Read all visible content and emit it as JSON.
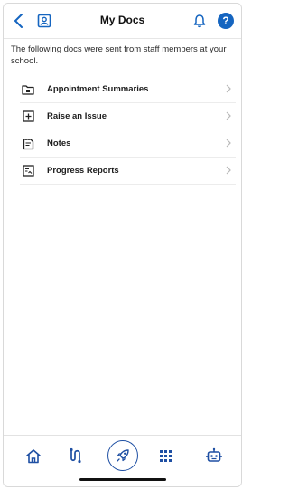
{
  "header": {
    "title": "My Docs",
    "icons": {
      "back": "back-chevron-icon",
      "profile": "profile-card-icon",
      "notifications": "bell-icon",
      "help": "help-icon"
    },
    "help_glyph": "?"
  },
  "intro_text": "The following docs were sent from staff members at your school.",
  "docs": [
    {
      "label": "Appointment Summaries",
      "icon": "folder-icon"
    },
    {
      "label": "Raise an Issue",
      "icon": "plus-box-icon"
    },
    {
      "label": "Notes",
      "icon": "note-icon"
    },
    {
      "label": "Progress Reports",
      "icon": "report-icon"
    }
  ],
  "bottom_nav": {
    "items": [
      "home-icon",
      "route-icon",
      "rocket-icon",
      "apps-grid-icon",
      "robot-icon"
    ]
  },
  "colors": {
    "accent": "#1565c0",
    "nav_accent": "#1e4fa3"
  }
}
